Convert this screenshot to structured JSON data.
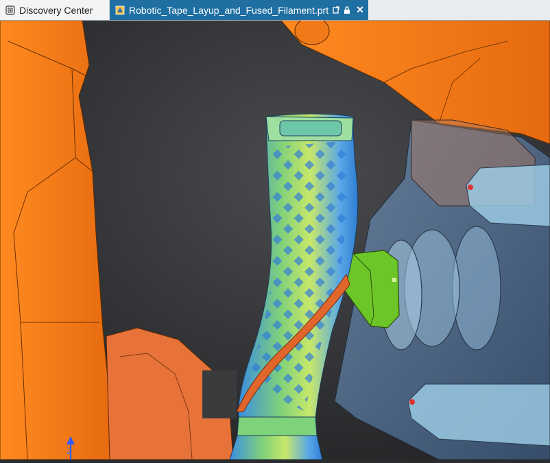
{
  "tabs": [
    {
      "label": "Discovery Center",
      "icon": "discovery-center-icon",
      "active": false
    },
    {
      "label": "Robotic_Tape_Layup_and_Fused_Filament.prt",
      "icon": "part-file-icon",
      "active": true
    }
  ],
  "active_tab_icons": [
    "detach-icon",
    "lock-icon",
    "close-icon"
  ],
  "axis": {
    "z_label": "Z"
  },
  "colors": {
    "robot_orange": "#f07a18",
    "robot_edge": "#5a2a00",
    "part_green": "#8fe26a",
    "part_blue": "#3a8ee0",
    "tool_green": "#7ed321",
    "tape_orange": "#e0662c",
    "glass_blue": "#8fb6d6",
    "background": "#2a2b2d",
    "tab_active": "#1f6fa3"
  }
}
